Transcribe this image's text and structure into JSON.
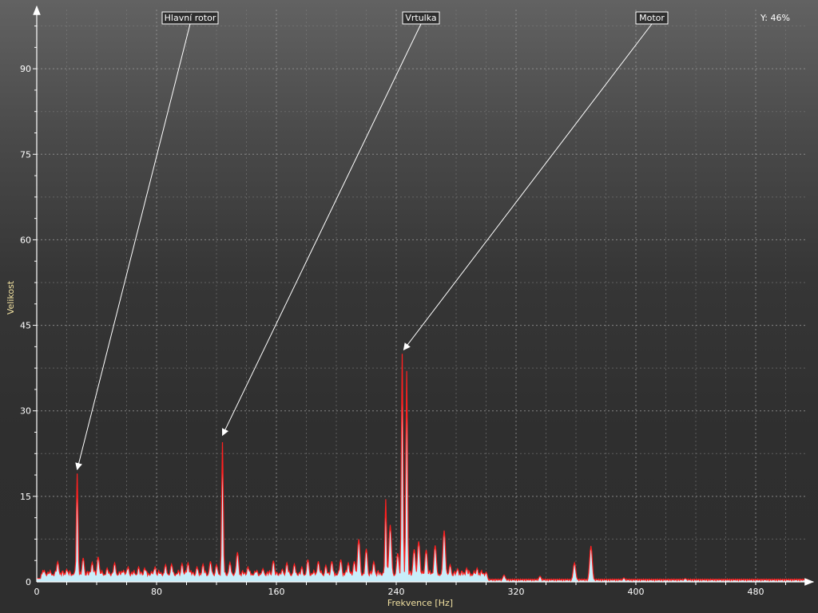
{
  "chart_data": {
    "type": "area",
    "xlabel": "Frekvence [Hz]",
    "ylabel": "Velikost",
    "xlim": [
      0,
      515
    ],
    "ylim": [
      0,
      100
    ],
    "xticks": [
      0,
      80,
      160,
      240,
      320,
      400,
      480
    ],
    "yticks": [
      0,
      15,
      30,
      45,
      60,
      75,
      90
    ],
    "grid": true,
    "line_color": "#ff2020",
    "fill_color": "#c8eefa",
    "readout": "Y: 46%",
    "annotations": [
      {
        "label": "Hlavní rotor",
        "target_x": 27,
        "target_y": 19
      },
      {
        "label": "Vrtulka",
        "target_x": 124,
        "target_y": 25
      },
      {
        "label": "Motor",
        "target_x": 245,
        "target_y": 40
      }
    ],
    "peaks": [
      [
        5,
        2.0
      ],
      [
        9,
        1.8
      ],
      [
        14,
        3.5
      ],
      [
        20,
        2.2
      ],
      [
        27,
        19.0
      ],
      [
        31,
        4.2
      ],
      [
        37,
        3.4
      ],
      [
        41,
        4.4
      ],
      [
        47,
        2.4
      ],
      [
        52,
        3.3
      ],
      [
        58,
        2.0
      ],
      [
        61,
        2.6
      ],
      [
        68,
        2.6
      ],
      [
        72,
        2.4
      ],
      [
        79,
        2.6
      ],
      [
        86,
        3.0
      ],
      [
        90,
        3.1
      ],
      [
        97,
        3.2
      ],
      [
        101,
        3.3
      ],
      [
        107,
        2.6
      ],
      [
        111,
        3.1
      ],
      [
        116,
        3.6
      ],
      [
        120,
        3.0
      ],
      [
        124,
        24.5
      ],
      [
        129,
        3.4
      ],
      [
        134,
        5.2
      ],
      [
        141,
        2.6
      ],
      [
        147,
        2.0
      ],
      [
        151,
        2.3
      ],
      [
        158,
        3.7
      ],
      [
        164,
        2.2
      ],
      [
        167,
        3.3
      ],
      [
        172,
        3.1
      ],
      [
        177,
        2.6
      ],
      [
        181,
        3.9
      ],
      [
        188,
        3.6
      ],
      [
        193,
        2.9
      ],
      [
        197,
        3.6
      ],
      [
        203,
        3.9
      ],
      [
        208,
        3.3
      ],
      [
        212,
        3.6
      ],
      [
        215,
        7.5
      ],
      [
        220,
        5.8
      ],
      [
        225,
        3.5
      ],
      [
        233,
        14.5
      ],
      [
        236,
        10.0
      ],
      [
        241,
        5.0
      ],
      [
        244,
        40.0
      ],
      [
        247,
        37.0
      ],
      [
        252,
        5.7
      ],
      [
        255,
        7.1
      ],
      [
        260,
        5.6
      ],
      [
        266,
        6.4
      ],
      [
        272,
        9.0
      ],
      [
        276,
        3.0
      ],
      [
        281,
        2.3
      ],
      [
        287,
        2.4
      ],
      [
        294,
        2.4
      ],
      [
        300,
        1.7
      ],
      [
        312,
        1.2
      ],
      [
        336,
        1.0
      ],
      [
        359,
        3.3
      ],
      [
        370,
        6.3
      ],
      [
        392,
        0.7
      ],
      [
        433,
        0.6
      ]
    ]
  }
}
